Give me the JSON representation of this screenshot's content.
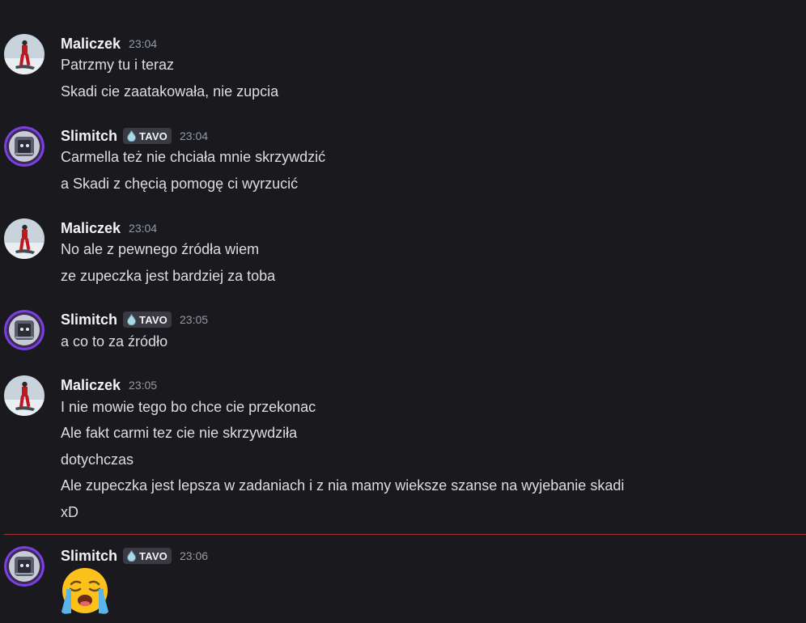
{
  "users": {
    "maliczek": "Maliczek",
    "slimitch": "Slimitch"
  },
  "tag_label": "TAVO",
  "colors": {
    "background": "#1a1a1e",
    "new_messages_divider": "#a3343a",
    "username": "#f2f3f5",
    "timestamp": "#949ba4",
    "text": "#dbdee1"
  },
  "groups": [
    {
      "user": "Maliczek",
      "time": "23:04",
      "lines": [
        "Patrzmy tu i teraz",
        "Skadi cie zaatakowała, nie zupcia"
      ]
    },
    {
      "user": "Slimitch",
      "time": "23:04",
      "lines": [
        "Carmella też nie chciała mnie skrzywdzić",
        "a Skadi z chęcią pomogę ci wyrzucić"
      ]
    },
    {
      "user": "Maliczek",
      "time": "23:04",
      "lines": [
        "No ale z pewnego źródła wiem",
        "ze zupeczka jest bardziej za toba"
      ]
    },
    {
      "user": "Slimitch",
      "time": "23:05",
      "lines": [
        "a co to za źródło"
      ]
    },
    {
      "user": "Maliczek",
      "time": "23:05",
      "lines": [
        "I nie mowie tego bo chce cie przekonac",
        "Ale fakt carmi tez cie nie skrzywdziła",
        "dotychczas",
        "Ale zupeczka jest lepsza w zadaniach i z nia mamy wieksze szanse na wyjebanie skadi",
        "xD"
      ]
    },
    {
      "user": "Slimitch",
      "time": "23:06",
      "emoji": "loudly-crying-face"
    }
  ]
}
